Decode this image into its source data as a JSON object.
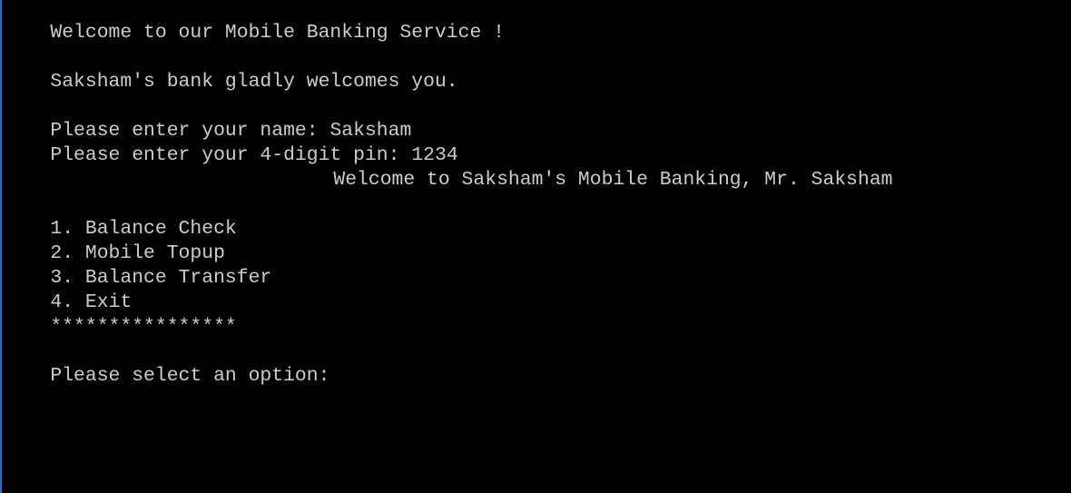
{
  "console": {
    "welcome_line": "Welcome to our Mobile Banking Service !",
    "bank_greeting": "Saksham's bank gladly welcomes you.",
    "name_prompt": "Please enter your name:",
    "name_value": "Saksham",
    "pin_prompt": "Please enter your 4-digit pin:",
    "pin_value": "1234",
    "personal_welcome": "Welcome to Saksham's Mobile Banking, Mr. Saksham",
    "menu": [
      "1. Balance Check",
      "2. Mobile Topup",
      "3. Balance Transfer",
      "4. Exit"
    ],
    "separator": "****************",
    "select_prompt": "Please select an option:"
  },
  "colors": {
    "background": "#000000",
    "text": "#cccccc",
    "left_border": "#1c6fc9"
  }
}
